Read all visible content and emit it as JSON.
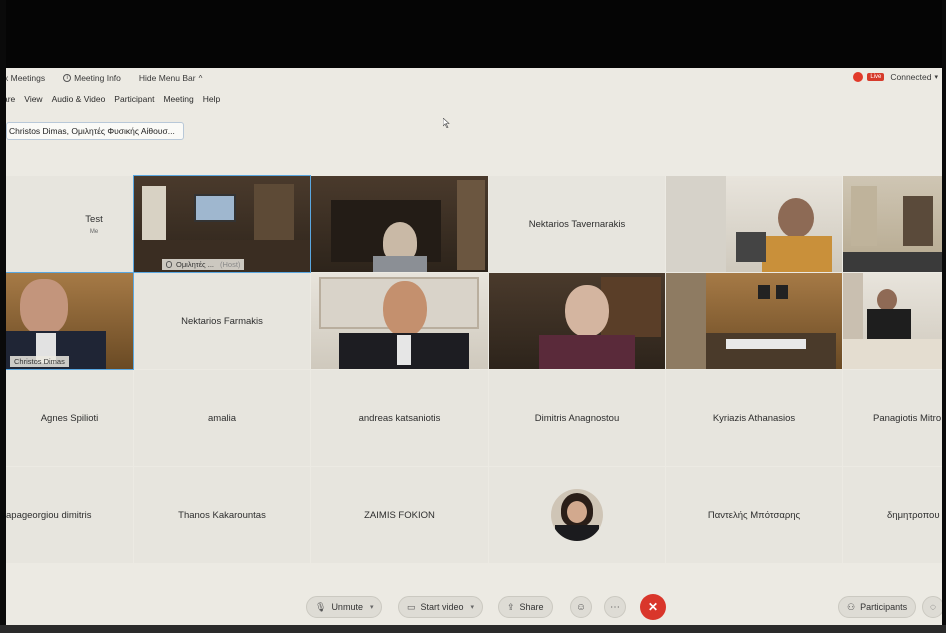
{
  "topbar": {
    "app_name": "x Meetings",
    "meeting_info": "Meeting Info",
    "hide_menu": "Hide Menu Bar",
    "live_label": "Live",
    "status": "Connected"
  },
  "menu": [
    "are",
    "View",
    "Audio & Video",
    "Participant",
    "Meeting",
    "Help"
  ],
  "speaker_tab": "Christos Dimas, Ομιλητές Φυσικής Αίθουσ...",
  "row1": [
    {
      "name": "Test",
      "sub": "Me"
    },
    {
      "overlay": "Ομιλητές ...",
      "host": "(Host)"
    },
    {
      "name": ""
    },
    {
      "name": "Nektarios Tavernarakis"
    },
    {
      "name": ""
    },
    {
      "name": ""
    }
  ],
  "row2": [
    {
      "plate": "Christos Dimas"
    },
    {
      "name": "Nektarios Farmakis"
    }
  ],
  "row3": [
    "Agnes Spilioti",
    "amalia",
    "andreas katsaniotis",
    "Dimitris Anagnostou",
    "Kyriazis Athanasios",
    "Panagiotis Mitro"
  ],
  "row4": [
    "apageorgiou dimitris",
    "Thanos Kakarountas",
    "ZAIMIS FOKION",
    "",
    "Παντελής Μπότσαρης",
    "δημητροπου"
  ],
  "toolbar": {
    "unmute": "Unmute",
    "start_video": "Start video",
    "share": "Share",
    "participants": "Participants"
  },
  "colors": {
    "end_call": "#d9362b",
    "active_border": "#5aa7e0",
    "background": "#eceae3"
  }
}
